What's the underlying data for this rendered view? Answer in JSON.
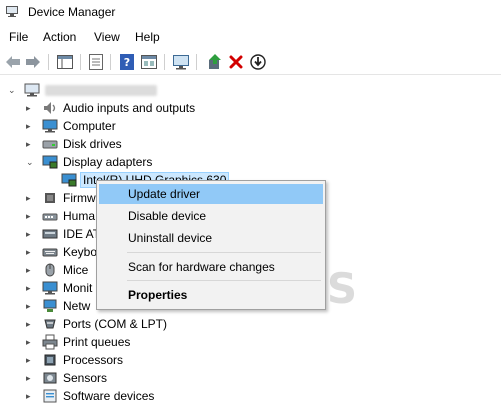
{
  "window": {
    "title": "Device Manager"
  },
  "menu": [
    "File",
    "Action",
    "View",
    "Help"
  ],
  "toolbar": {
    "icons": [
      "back-arrow-icon",
      "forward-arrow-icon",
      "show-hide-tree-icon",
      "properties-icon",
      "help-icon",
      "view-icon",
      "scan-hardware-icon",
      "update-driver-icon",
      "uninstall-icon",
      "disable-device-icon"
    ]
  },
  "tree": {
    "root": {
      "label": "",
      "expanded": true
    },
    "categories": [
      {
        "label": "Audio inputs and outputs",
        "icon": "speaker-icon",
        "expanded": false
      },
      {
        "label": "Computer",
        "icon": "monitor-icon",
        "expanded": false
      },
      {
        "label": "Disk drives",
        "icon": "disk-icon",
        "expanded": false
      },
      {
        "label": "Display adapters",
        "icon": "display-adapter-icon",
        "expanded": true
      },
      {
        "label": "Firmw",
        "icon": "chip-icon",
        "expanded": false
      },
      {
        "label": "Huma",
        "icon": "hid-icon",
        "expanded": false
      },
      {
        "label": "IDE AT",
        "icon": "ide-icon",
        "expanded": false
      },
      {
        "label": "Keybo",
        "icon": "keyboard-icon",
        "expanded": false
      },
      {
        "label": "Mice",
        "icon": "mouse-icon",
        "expanded": false
      },
      {
        "label": "Monit",
        "icon": "monitor-icon",
        "expanded": false
      },
      {
        "label": "Netw",
        "icon": "network-icon",
        "expanded": false
      },
      {
        "label": "Ports (COM & LPT)",
        "icon": "port-icon",
        "expanded": false
      },
      {
        "label": "Print queues",
        "icon": "printer-icon",
        "expanded": false
      },
      {
        "label": "Processors",
        "icon": "processor-icon",
        "expanded": false
      },
      {
        "label": "Sensors",
        "icon": "sensor-icon",
        "expanded": false
      },
      {
        "label": "Software devices",
        "icon": "software-device-icon",
        "expanded": false
      }
    ],
    "selected_child": {
      "label": "Intel(R) UHD Graphics 630",
      "icon": "display-adapter-icon"
    }
  },
  "context_menu": {
    "items": [
      {
        "label": "Update driver",
        "highlighted": true
      },
      {
        "label": "Disable device"
      },
      {
        "label": "Uninstall device"
      },
      {
        "label": "Scan for hardware changes"
      },
      {
        "label": "Properties",
        "bold": true
      }
    ]
  },
  "watermark": {
    "text": "A PUALS"
  },
  "colors": {
    "highlight": "#91c9f7",
    "selection": "#cce8ff",
    "menu_bg": "#f2f2f2",
    "uninstall_red": "#d20000"
  }
}
